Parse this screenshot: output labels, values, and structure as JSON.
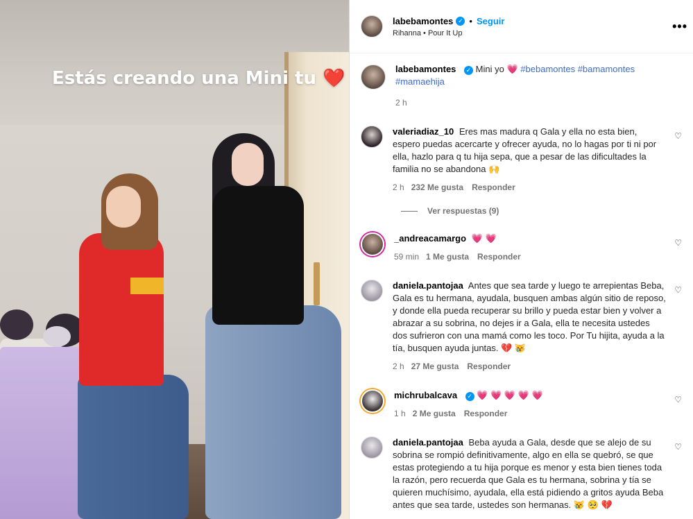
{
  "media": {
    "overlay_text": "Estás creando una Mini tu",
    "overlay_emoji": "❤️"
  },
  "post": {
    "username": "labebamontes",
    "verified_icon": "verified-badge-icon",
    "separator": "•",
    "follow_label": "Seguir",
    "music": "Rihanna • Pour It Up",
    "more_label": "•••"
  },
  "caption": {
    "username": "labebamontes",
    "text": "Mini yo",
    "emoji": "💗",
    "hashtags": "#bebamontes #bamamontes #mamaehija",
    "time": "2 h"
  },
  "comments": [
    {
      "username": "valeriadiaz_10",
      "text": "Eres mas madura q Gala y ella no esta bien, espero puedas acercarte y ofrecer ayuda, no lo hagas por ti ni por ella, hazlo para q tu hija sepa, que a pesar de las dificultades la familia no se abandona 🙌",
      "time": "2 h",
      "likes": "232 Me gusta",
      "reply": "Responder",
      "view_replies": "Ver respuestas (9)"
    },
    {
      "username": "_andreacamargo",
      "text": "💗 💗",
      "time": "59 min",
      "likes": "1 Me gusta",
      "reply": "Responder"
    },
    {
      "username": "daniela.pantojaa",
      "text": "Antes que sea tarde y luego te arrepientas Beba, Gala es tu hermana, ayudala, busquen ambas algún sitio de reposo, y donde ella pueda recuperar su brillo y pueda estar bien y volver a abrazar a su sobrina, no dejes ir a Gala, ella te necesita ustedes dos sufrieron con una mamá como les toco. Por Tu hijita, ayuda a la tía, busquen ayuda juntas. 💔 😿",
      "time": "2 h",
      "likes": "27 Me gusta",
      "reply": "Responder"
    },
    {
      "username": "michrubalcava",
      "text": "💗 💗 💗 💗 💗",
      "time": "1 h",
      "likes": "2 Me gusta",
      "reply": "Responder"
    },
    {
      "username": "daniela.pantojaa",
      "text": "Beba ayuda a Gala, desde que se alejo de su sobrina se rompió definitivamente, algo en ella se quebró, se que estas protegiendo a tu hija porque es menor y esta bien tienes toda la razón, pero recuerda que Gala es tu hermana, sobrina y tía se quieren muchísimo, ayudala, ella está pidiendo a gritos ayuda Beba antes que sea tarde, ustedes son hermanas. 😿 🥺 💔"
    }
  ],
  "icons": {
    "like": "heart-outline-icon",
    "more": "more-options-icon"
  }
}
